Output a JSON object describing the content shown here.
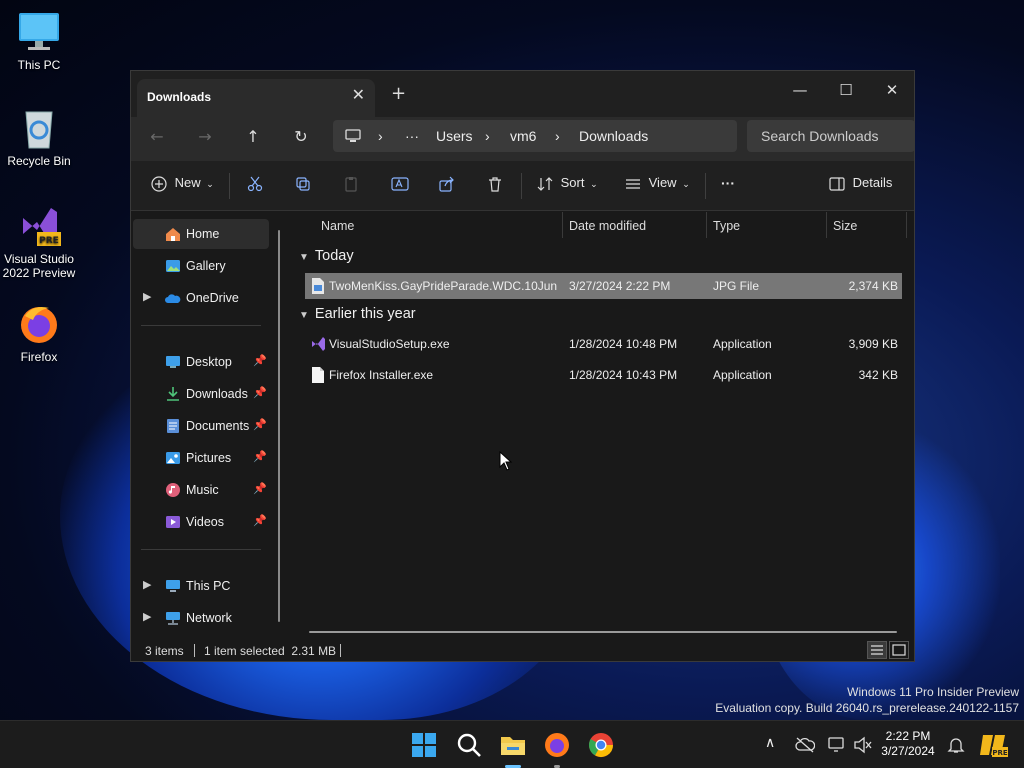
{
  "desktop": {
    "icons": [
      {
        "label": "This PC"
      },
      {
        "label": "Recycle Bin"
      },
      {
        "label": "Visual Studio 2022 Preview",
        "badge": "PRE"
      },
      {
        "label": "Firefox"
      }
    ],
    "watermark": {
      "line1": "Windows 11 Pro Insider Preview",
      "line2": "Evaluation copy. Build 26040.rs_prerelease.240122-1157"
    }
  },
  "window": {
    "tab_title": "Downloads",
    "tab_close": "✕",
    "new_tab": "+",
    "controls": {
      "minimize": "—",
      "maximize": "☐",
      "close": "✕"
    },
    "nav": {
      "back": "←",
      "forward": "→",
      "up": "↑",
      "refresh": "↻"
    },
    "breadcrumb": [
      "Users",
      "vm6",
      "Downloads"
    ],
    "breadcrumb_more": "···",
    "breadcrumb_sep": "›",
    "search_placeholder": "Search Downloads",
    "toolbar": {
      "new_label": "New",
      "sort_label": "Sort",
      "view_label": "View",
      "more_label": "···",
      "details_label": "Details"
    },
    "sidebar": {
      "items": [
        {
          "label": "Home",
          "active": true
        },
        {
          "label": "Gallery"
        },
        {
          "label": "OneDrive"
        },
        {
          "label": "Desktop",
          "pinned": true
        },
        {
          "label": "Downloads",
          "pinned": true
        },
        {
          "label": "Documents",
          "pinned": true
        },
        {
          "label": "Pictures",
          "pinned": true
        },
        {
          "label": "Music",
          "pinned": true
        },
        {
          "label": "Videos",
          "pinned": true
        },
        {
          "label": "This PC"
        },
        {
          "label": "Network"
        }
      ]
    },
    "columns": [
      "Name",
      "Date modified",
      "Type",
      "Size"
    ],
    "groups": [
      {
        "label": "Today",
        "files": [
          {
            "name": "TwoMenKiss.GayPrideParade.WDC.10Jun...",
            "date": "3/27/2024 2:22 PM",
            "type": "JPG File",
            "size": "2,374 KB",
            "selected": true
          }
        ]
      },
      {
        "label": "Earlier this year",
        "files": [
          {
            "name": "VisualStudioSetup.exe",
            "date": "1/28/2024 10:48 PM",
            "type": "Application",
            "size": "3,909 KB"
          },
          {
            "name": "Firefox Installer.exe",
            "date": "1/28/2024 10:43 PM",
            "type": "Application",
            "size": "342 KB"
          }
        ]
      }
    ],
    "status": {
      "count": "3 items",
      "selection": "1 item selected  2.31 MB"
    }
  },
  "taskbar": {
    "clock_time": "2:22 PM",
    "clock_date": "3/27/2024",
    "tray_chevron": "∧",
    "tray_badge": "PRE"
  },
  "colors": {
    "accent_blue": "#0078d4",
    "folder_yellow": "#f2c94c",
    "window_bg": "#191919",
    "selection": "#777777"
  }
}
